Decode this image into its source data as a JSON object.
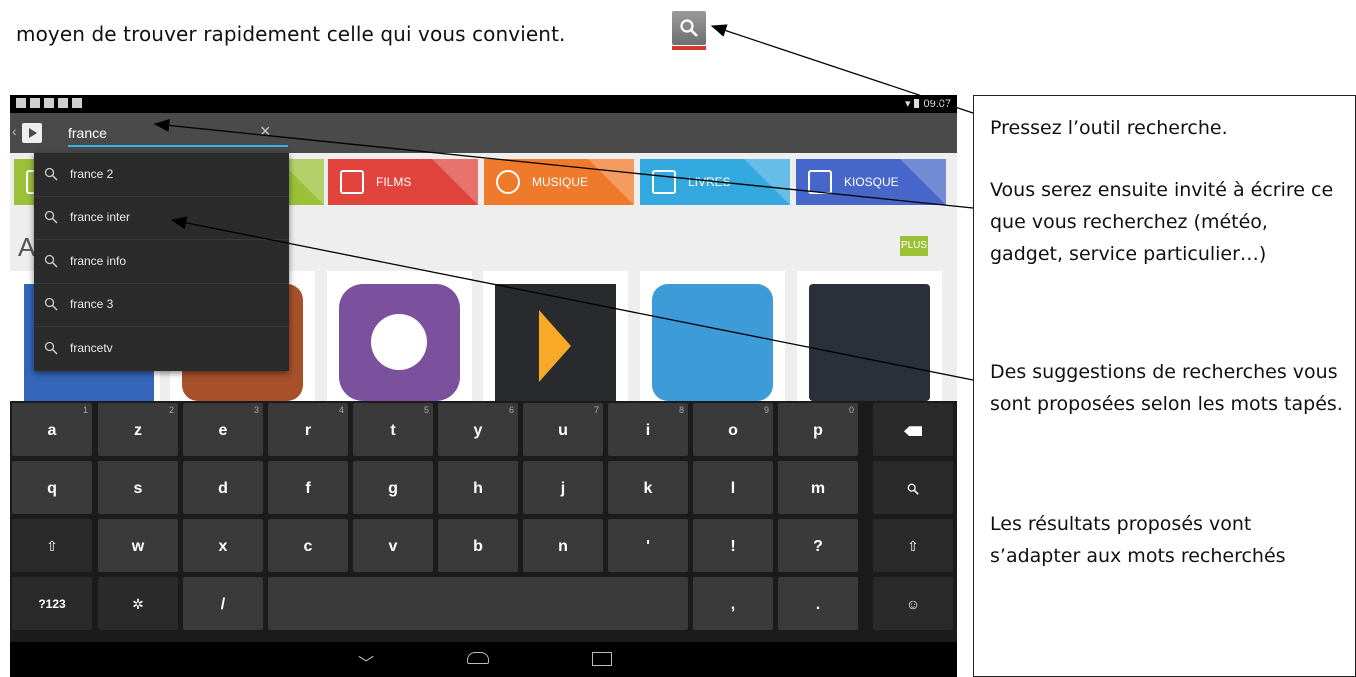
{
  "doc": {
    "intro_text": "moyen de trouver rapidement celle qui vous convient."
  },
  "status": {
    "time": "09:07"
  },
  "search": {
    "query": "france"
  },
  "tiles": [
    {
      "label": "",
      "color": "#9bc139"
    },
    {
      "label": "FILMS",
      "color": "#e0443c"
    },
    {
      "label": "MUSIQUE",
      "color": "#f07a2b"
    },
    {
      "label": "LIVRES",
      "color": "#33a9e0"
    },
    {
      "label": "KIOSQUE",
      "color": "#4666c9"
    }
  ],
  "section": {
    "letter": "A",
    "plus_label": "PLUS"
  },
  "suggestions": [
    "france 2",
    "france inter",
    "france info",
    "france 3",
    "francetv"
  ],
  "keyboard": {
    "row1": [
      {
        "label": "a",
        "num": "1"
      },
      {
        "label": "z",
        "num": "2"
      },
      {
        "label": "e",
        "num": "3"
      },
      {
        "label": "r",
        "num": "4"
      },
      {
        "label": "t",
        "num": "5"
      },
      {
        "label": "y",
        "num": "6"
      },
      {
        "label": "u",
        "num": "7"
      },
      {
        "label": "i",
        "num": "8"
      },
      {
        "label": "o",
        "num": "9"
      },
      {
        "label": "p",
        "num": "0"
      }
    ],
    "row2": [
      "q",
      "s",
      "d",
      "f",
      "g",
      "h",
      "j",
      "k",
      "l",
      "m"
    ],
    "row3": [
      "w",
      "x",
      "c",
      "v",
      "b",
      "n",
      "'",
      "!",
      "?"
    ],
    "row4": {
      "mode_label": "?123",
      "slash": "/",
      "comma": ",",
      "period": "."
    }
  },
  "callout": {
    "p1": "Pressez l’outil recherche.",
    "p2": "Vous serez ensuite invité à écrire ce que vous recherchez (météo, gadget, service particulier…)",
    "p3": "Des suggestions de recherches vous sont proposées selon les mots tapés.",
    "p4": "Les résultats proposés vont s’adapter aux mots recherchés"
  },
  "colors": {
    "accent": "#33b5e5",
    "plus": "#9bc139",
    "keyboard": "#1b1b1b",
    "tool_bar": "#d23a2a"
  },
  "icons": [
    "search-icon",
    "play-store-icon",
    "close-icon",
    "wifi-icon",
    "battery-icon",
    "backspace-icon",
    "shift-icon",
    "gear-icon",
    "smiley-icon",
    "nav-back-icon",
    "nav-home-icon",
    "nav-recents-icon"
  ]
}
